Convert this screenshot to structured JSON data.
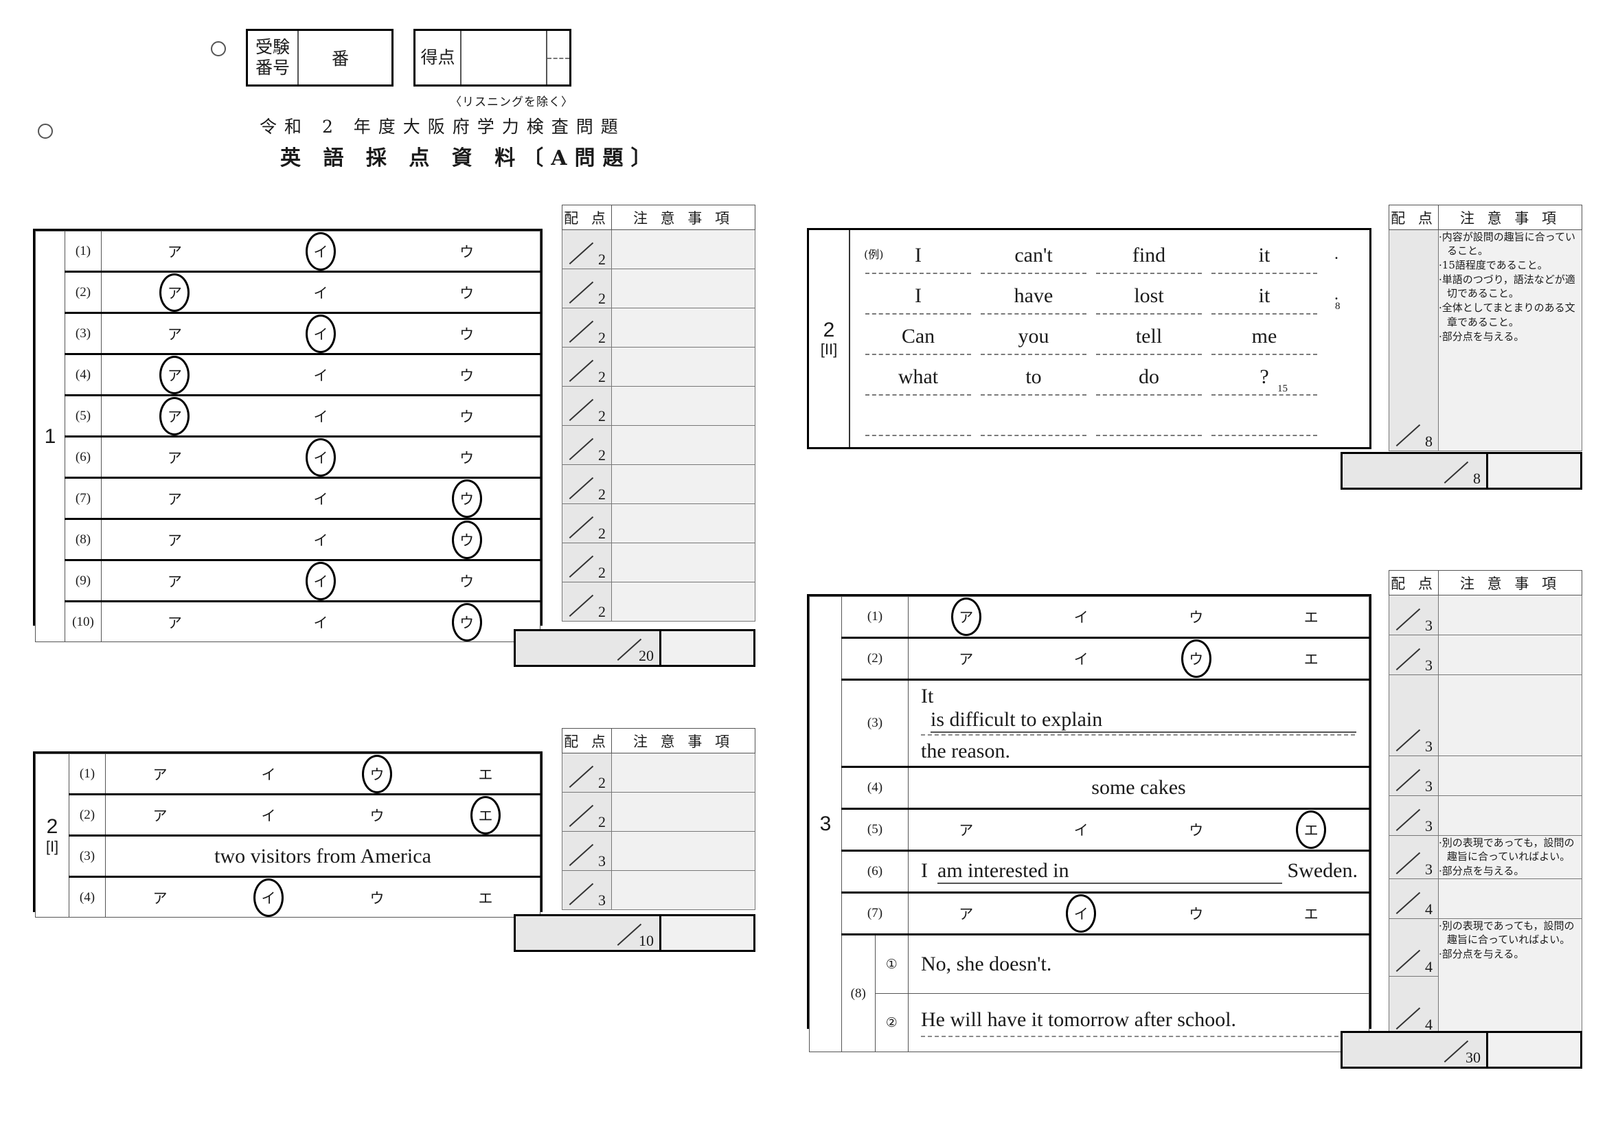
{
  "header": {
    "exam_no_label": "受験\n番号",
    "exam_no_label_line1": "受験",
    "exam_no_label_line2": "番号",
    "ban": "番",
    "score_label": "得点",
    "listening_note": "〈リスニングを除く〉",
    "title_line1": "令和 2 年度大阪府学力検査問題",
    "title_line2": "英 語 採 点 資 料〔A問題〕"
  },
  "side_headers": {
    "points": "配 点",
    "notes": "注 意 事 項"
  },
  "q1": {
    "number": "1",
    "choices": [
      "ア",
      "イ",
      "ウ"
    ],
    "rows": [
      {
        "no": "(1)",
        "answer": "イ",
        "points": "2"
      },
      {
        "no": "(2)",
        "answer": "ア",
        "points": "2"
      },
      {
        "no": "(3)",
        "answer": "イ",
        "points": "2"
      },
      {
        "no": "(4)",
        "answer": "ア",
        "points": "2"
      },
      {
        "no": "(5)",
        "answer": "ア",
        "points": "2"
      },
      {
        "no": "(6)",
        "answer": "イ",
        "points": "2"
      },
      {
        "no": "(7)",
        "answer": "ウ",
        "points": "2"
      },
      {
        "no": "(8)",
        "answer": "ウ",
        "points": "2"
      },
      {
        "no": "(9)",
        "answer": "イ",
        "points": "2"
      },
      {
        "no": "(10)",
        "answer": "ウ",
        "points": "2"
      }
    ],
    "total": "20"
  },
  "q2_1": {
    "number": "2",
    "sub": "[I]",
    "choices": [
      "ア",
      "イ",
      "ウ",
      "エ"
    ],
    "rows": [
      {
        "no": "(1)",
        "type": "choice",
        "answer": "ウ",
        "points": "2"
      },
      {
        "no": "(2)",
        "type": "choice",
        "answer": "エ",
        "points": "2"
      },
      {
        "no": "(3)",
        "type": "text",
        "text": "two visitors from America",
        "points": "3"
      },
      {
        "no": "(4)",
        "type": "choice",
        "answer": "イ",
        "points": "3"
      }
    ],
    "total": "10"
  },
  "q2_2": {
    "number": "2",
    "sub": "[II]",
    "example_label": "(例)",
    "lines": [
      {
        "words": [
          "I",
          "can't",
          "find",
          "it"
        ],
        "tail": ".",
        "count": ""
      },
      {
        "words": [
          "I",
          "have",
          "lost",
          "it"
        ],
        "tail": ".",
        "count": "8"
      },
      {
        "words": [
          "Can",
          "you",
          "tell",
          "me"
        ],
        "tail": "",
        "count": ""
      },
      {
        "words": [
          "what",
          "to",
          "do",
          "?"
        ],
        "tail": "",
        "count": "15"
      },
      {
        "words": [
          "",
          "",
          "",
          ""
        ],
        "tail": "",
        "count": ""
      }
    ],
    "notes": [
      "内容が設問の趣旨に合っていること。",
      "15語程度であること。",
      "単語のつづり，語法などが適切であること。",
      "全体としてまとまりのある文章であること。",
      "部分点を与える。"
    ],
    "points": "8",
    "total": "8"
  },
  "q3": {
    "number": "3",
    "choices": [
      "ア",
      "イ",
      "ウ",
      "エ"
    ],
    "rows": [
      {
        "no": "(1)",
        "type": "choice",
        "answer": "ア",
        "points": "3",
        "notes": []
      },
      {
        "no": "(2)",
        "type": "choice",
        "answer": "ウ",
        "points": "3",
        "notes": []
      },
      {
        "no": "(3)",
        "type": "fill2",
        "prefix": "It",
        "blank": "is difficult to explain",
        "suffix": "the reason.",
        "points": "3",
        "notes": []
      },
      {
        "no": "(4)",
        "type": "text",
        "text": "some cakes",
        "points": "3",
        "notes": []
      },
      {
        "no": "(5)",
        "type": "choice",
        "answer": "エ",
        "points": "3",
        "notes": []
      },
      {
        "no": "(6)",
        "type": "fillmid",
        "prefix": "I",
        "blank": "am interested in",
        "suffix": "Sweden.",
        "points": "3",
        "notes": [
          "別の表現であっても，設問の趣旨に合っていればよい。",
          "部分点を与える。"
        ]
      },
      {
        "no": "(7)",
        "type": "choice",
        "answer": "イ",
        "points": "4",
        "notes": []
      },
      {
        "no": "(8)",
        "type": "subtext",
        "sub1": "①",
        "text1": "No, she doesn't.",
        "sub2": "②",
        "text2": "He will have it tomorrow after school.",
        "points1": "4",
        "points2": "4",
        "notes": [
          "別の表現であっても，設問の趣旨に合っていればよい。",
          "部分点を与える。"
        ]
      }
    ],
    "total": "30"
  }
}
